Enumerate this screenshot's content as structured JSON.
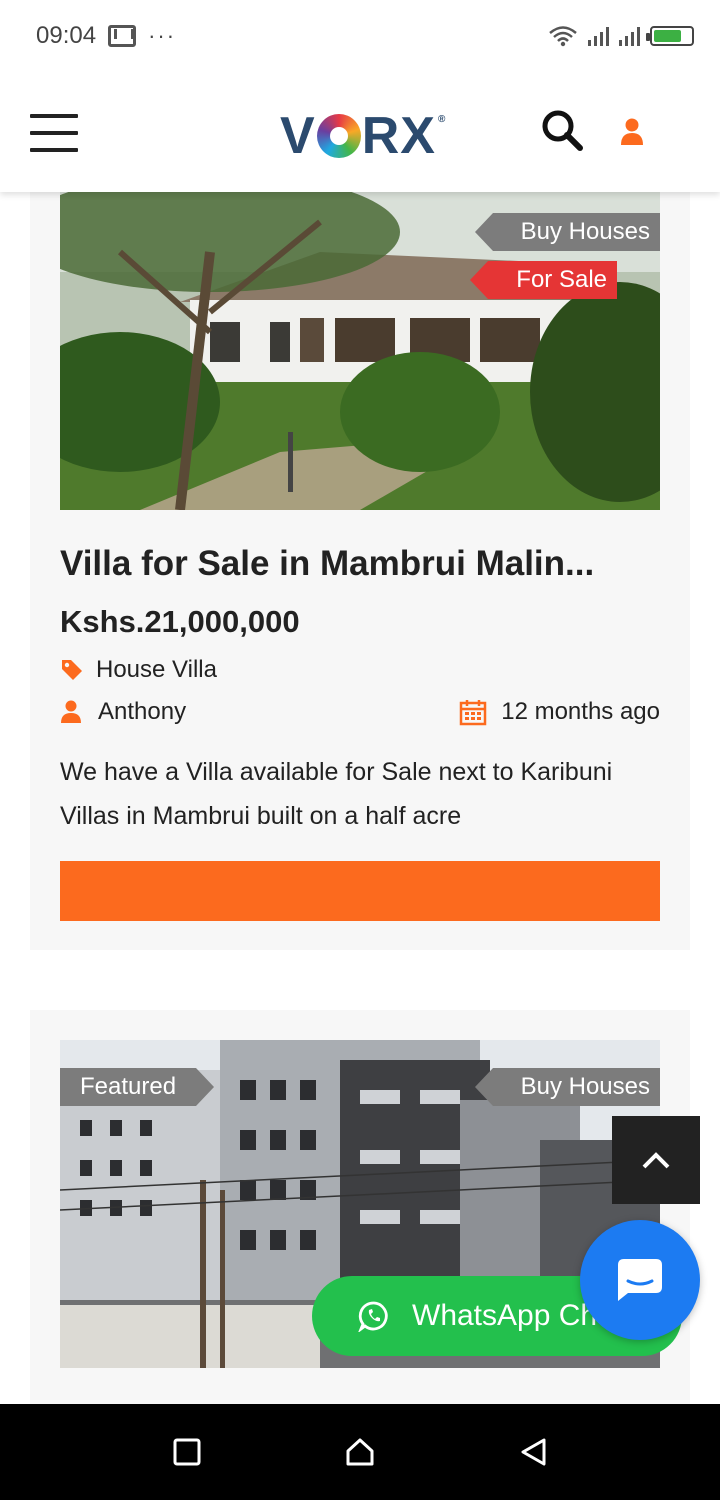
{
  "status_bar": {
    "time": "09:04",
    "more": "···"
  },
  "header": {
    "logo_text_left": "V",
    "logo_text_right": "RX",
    "logo_reg": "®",
    "menu_icon": "hamburger-icon",
    "search_icon": "search-icon",
    "user_icon": "user-icon"
  },
  "listings": [
    {
      "tags": [
        "Buy Houses",
        "For Sale"
      ],
      "title": "Villa for Sale in Mambrui Malin...",
      "price": "Kshs.21,000,000",
      "category": "House Villa",
      "agent": "Anthony",
      "posted": "12 months ago",
      "description": "We have a Villa available for Sale next to Karibuni Villas in Mambrui built on a half acre"
    },
    {
      "tags": [
        "Featured",
        "Buy Houses"
      ]
    }
  ],
  "floating": {
    "whatsapp_label": "WhatsApp Ch",
    "scroll_top_icon": "chevron-up-icon",
    "chat_icon": "chat-bubble-icon"
  },
  "colors": {
    "accent": "#fc6a1e",
    "tag_red": "#e53535",
    "tag_grey": "#7c7c7c",
    "whatsapp": "#23c04d",
    "chat": "#1c7bf2"
  }
}
